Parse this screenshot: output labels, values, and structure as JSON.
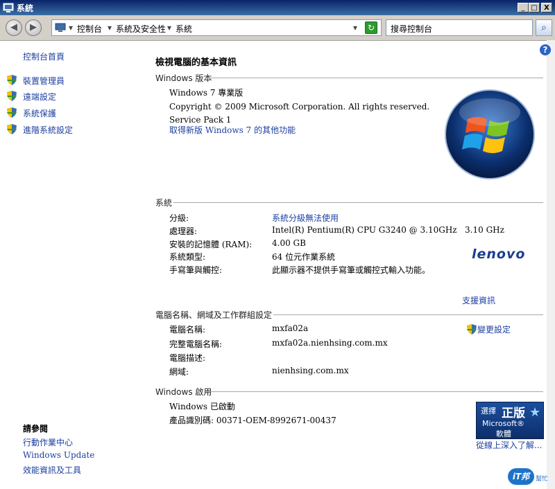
{
  "window": {
    "title": "系統",
    "min_label": "_",
    "max_label": "□",
    "close_label": "X"
  },
  "address": {
    "crumbs": [
      "控制台",
      "系統及安全性",
      "系統"
    ],
    "search_placeholder": "搜尋控制台",
    "back_glyph": "◀",
    "forward_glyph": "▶",
    "refresh_glyph": "↻",
    "search_glyph": "⌕"
  },
  "sidebar": {
    "home": "控制台首頁",
    "tasks": [
      "裝置管理員",
      "遠端設定",
      "系統保護",
      "進階系統設定"
    ],
    "see_also_title": "請參閱",
    "see_also": [
      "行動作業中心",
      "Windows Update",
      "效能資訊及工具"
    ]
  },
  "main": {
    "heading": "檢視電腦的基本資訊",
    "edition": {
      "section": "Windows 版本",
      "name": "Windows 7 專業版",
      "copyright": "Copyright © 2009 Microsoft Corporation.  All rights reserved.",
      "service_pack": "Service Pack 1",
      "upgrade_link": "取得新版 Windows 7 的其他功能"
    },
    "system": {
      "section": "系統",
      "rows": [
        {
          "label": "分級:",
          "value": "系統分級無法使用"
        },
        {
          "label": "處理器:",
          "value": "Intel(R) Pentium(R) CPU G3240 @ 3.10GHz   3.10 GHz"
        },
        {
          "label": "安裝的記憶體 (RAM):",
          "value": "4.00 GB"
        },
        {
          "label": "系統類型:",
          "value": "64 位元作業系統"
        },
        {
          "label": "手寫筆與觸控:",
          "value": "此顯示器不提供手寫筆或觸控式輸入功能。"
        }
      ],
      "oem_logo": "lenovo",
      "support_link": "支援資訊"
    },
    "computer": {
      "section": "電腦名稱、網域及工作群組設定",
      "rows": [
        {
          "label": "電腦名稱:",
          "value": "mxfa02a"
        },
        {
          "label": "完整電腦名稱:",
          "value": "mxfa02a.nienhsing.com.mx"
        },
        {
          "label": "電腦描述:",
          "value": ""
        },
        {
          "label": "網域:",
          "value": "nienhsing.com.mx"
        }
      ],
      "change_link": "變更設定"
    },
    "activation": {
      "section": "Windows 啟用",
      "status": "Windows 已啟動",
      "product_id": "產品識別碼: 00371-OEM-8992671-00437",
      "genuine_line1": "選擇",
      "genuine_line2": "正版",
      "genuine_line3": "Microsoft®",
      "genuine_line4": "軟體",
      "learn_more": "從線上深入了解..."
    }
  },
  "watermark": {
    "text": "iT邦",
    "sub": "幫忙"
  },
  "colors": {
    "link": "#1c3fa0",
    "title_bar": "#0a246a",
    "lenovo": "#1b3c8f"
  }
}
